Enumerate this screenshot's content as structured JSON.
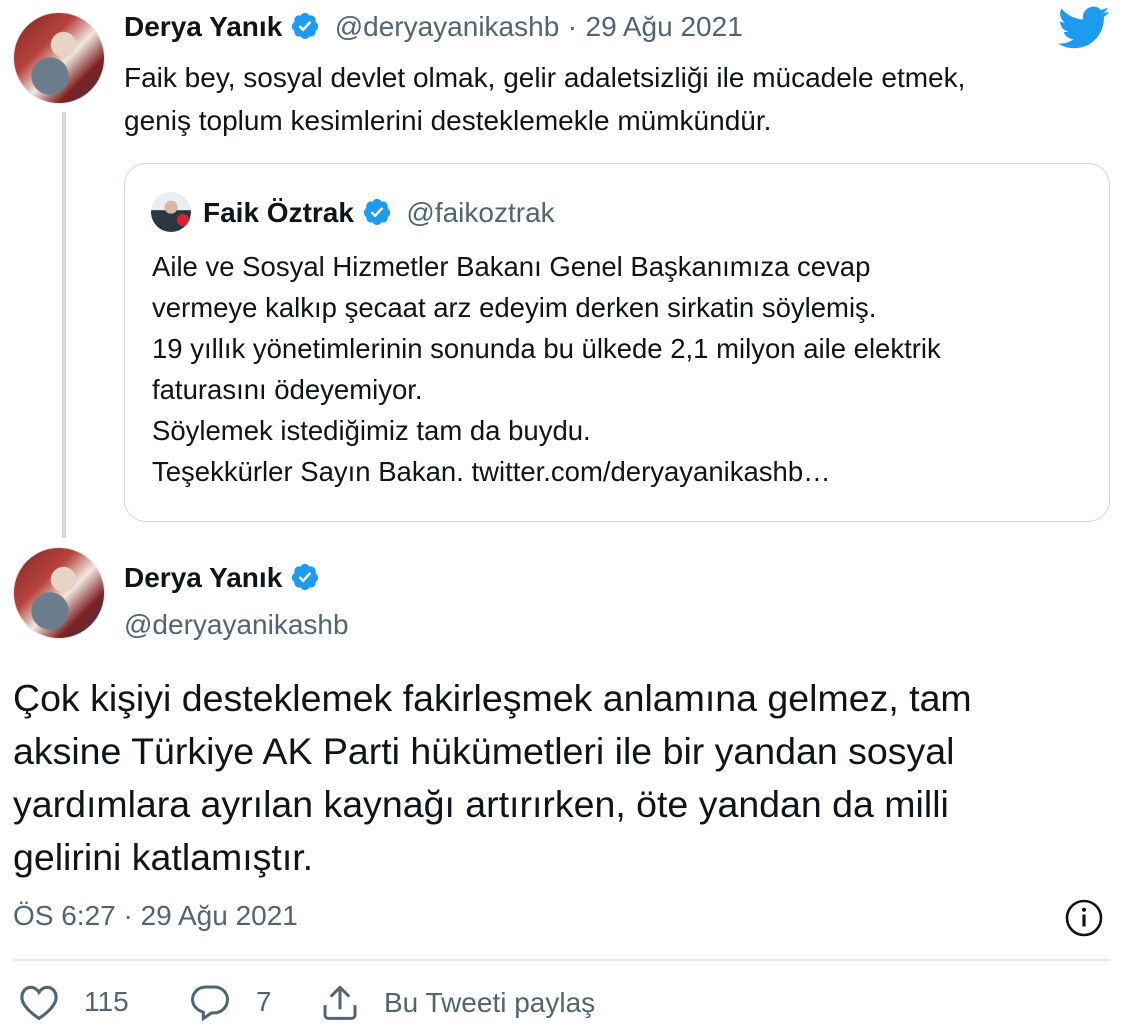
{
  "parent_tweet": {
    "author_name": "Derya Yanık",
    "handle": "@deryayanikashb",
    "separator": "·",
    "date": "29 Ağu 2021",
    "text_lines": [
      "Faik bey, sosyal devlet olmak, gelir adaletsizliği ile mücadele etmek,",
      "geniş toplum kesimlerini desteklemekle mümkündür."
    ],
    "quoted_tweet": {
      "author_name": "Faik Öztrak",
      "handle": "@faikoztrak",
      "text_lines": [
        "Aile ve Sosyal Hizmetler Bakanı Genel Başkanımıza cevap",
        "vermeye kalkıp şecaat arz edeyim derken sirkatin söylemiş.",
        "19 yıllık yönetimlerinin sonunda bu ülkede 2,1 milyon aile elektrik",
        "faturasını ödeyemiyor.",
        "Söylemek istediğimiz tam da buydu.",
        "Teşekkürler Sayın Bakan. twitter.com/deryayanikashb…"
      ]
    }
  },
  "main_tweet": {
    "author_name": "Derya Yanık",
    "handle": "@deryayanikashb",
    "text_lines": [
      "Çok kişiyi desteklemek fakirleşmek anlamına gelmez, tam",
      "aksine Türkiye AK Parti hükümetleri ile bir yandan sosyal",
      "yardımlara ayrılan kaynağı artırırken, öte yandan da milli",
      "gelirini katlamıştır."
    ],
    "timestamp": "ÖS 6:27 · 29 Ağu 2021",
    "actions": {
      "like_count": "115",
      "reply_count": "7",
      "share_label": "Bu Tweeti paylaş"
    }
  },
  "icons": {
    "brand": "twitter-bird-icon",
    "verified": "verified-badge-icon",
    "info": "info-icon",
    "like": "heart-icon",
    "reply": "reply-bubble-icon",
    "share": "share-icon"
  },
  "colors": {
    "brand_blue": "#1d9bf0",
    "text_primary": "#0f1419",
    "text_secondary": "#536471",
    "border": "#cfd9de"
  }
}
